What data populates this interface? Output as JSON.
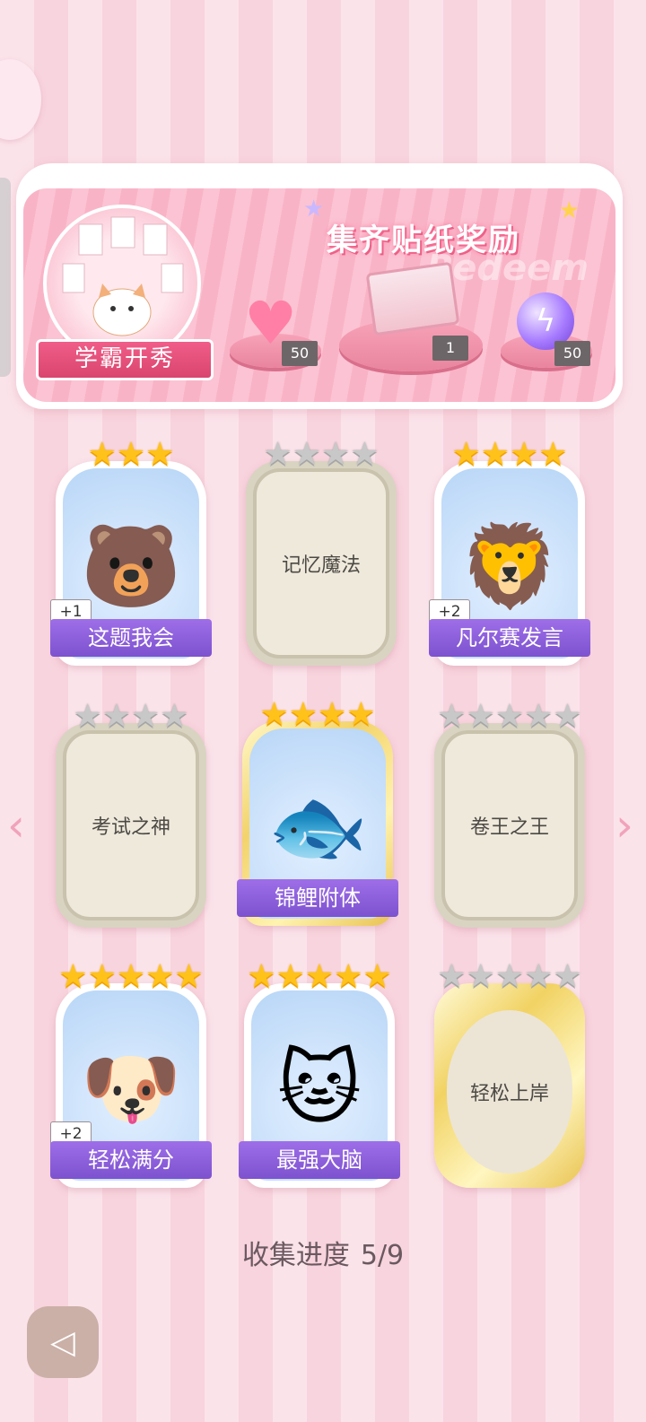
{
  "banner": {
    "title": "集齐贴纸奖励",
    "watermark": "Redeem",
    "hero_label": "学霸开秀",
    "rewards": [
      {
        "icon": "pink-heart-gem-icon",
        "count": "50"
      },
      {
        "icon": "gift-box-icon",
        "count": "1"
      },
      {
        "icon": "purple-lightning-orb-icon",
        "count": "50"
      }
    ]
  },
  "cards": [
    {
      "name": "这题我会",
      "stars_on": 3,
      "stars_total": 3,
      "state": "collected",
      "badge": "+1",
      "icon": "bear-at-desk-icon"
    },
    {
      "name": "记忆魔法",
      "stars_on": 0,
      "stars_total": 4,
      "state": "locked",
      "badge": "",
      "icon": ""
    },
    {
      "name": "凡尔赛发言",
      "stars_on": 4,
      "stars_total": 4,
      "state": "collected",
      "badge": "+2",
      "icon": "lion-microphone-icon"
    },
    {
      "name": "考试之神",
      "stars_on": 0,
      "stars_total": 4,
      "state": "locked",
      "badge": "",
      "icon": ""
    },
    {
      "name": "锦鲤附体",
      "stars_on": 4,
      "stars_total": 4,
      "state": "collected-gold",
      "badge": "",
      "icon": "bear-koi-fish-icon"
    },
    {
      "name": "卷王之王",
      "stars_on": 0,
      "stars_total": 5,
      "state": "locked",
      "badge": "",
      "icon": ""
    },
    {
      "name": "轻松满分",
      "stars_on": 5,
      "stars_total": 5,
      "state": "collected",
      "badge": "+2",
      "icon": "puppy-full-score-icon"
    },
    {
      "name": "最强大脑",
      "stars_on": 5,
      "stars_total": 5,
      "state": "collected",
      "badge": "",
      "icon": "cat-with-papers-icon"
    },
    {
      "name": "轻松上岸",
      "stars_on": 0,
      "stars_total": 5,
      "state": "locked-gold",
      "badge": "",
      "icon": ""
    }
  ],
  "progress": {
    "label": "收集进度",
    "value": "5/9",
    "collected": 5,
    "total": 9
  },
  "colors": {
    "accent_pink": "#f05d88",
    "label_purple": "#8a5fdb",
    "star_gold": "#ffc21a"
  }
}
